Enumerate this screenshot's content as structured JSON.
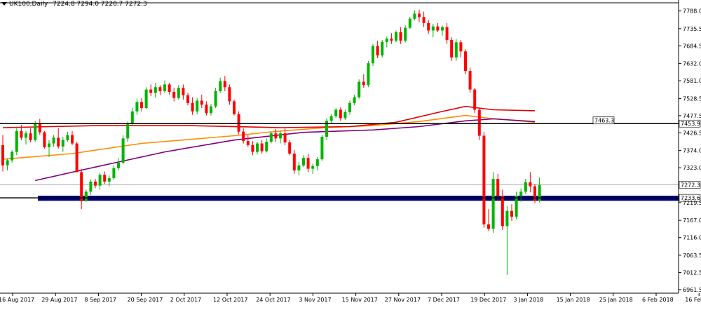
{
  "header": {
    "symbol": "UK100,Daily",
    "ohlc": "7224.8 7294.0 7220.7 7272.3"
  },
  "colors": {
    "bull": "#00b400",
    "bear": "#ff0000",
    "ma_fast": "#ff8c00",
    "ma_mid": "#e00000",
    "ma_slow": "#800080",
    "support_zone": "#000080",
    "hline": "#000000",
    "current_price_line": "#b0b0b0",
    "background": "#ffffff"
  },
  "chart_data": {
    "type": "candlestick",
    "title": "UK100,Daily",
    "y_ticks": [
      "7788.0",
      "7735.5",
      "7684.5",
      "7632.0",
      "7581.0",
      "7528.5",
      "7477.5",
      "7426.5",
      "7374.0",
      "7323.0",
      "7219.5",
      "7167.0",
      "7116.0",
      "7063.5",
      "7012.5",
      "6961.5"
    ],
    "x_ticks": [
      "16 Aug 2017",
      "29 Aug 2017",
      "8 Sep 2017",
      "20 Sep 2017",
      "2 Oct 2017",
      "12 Oct 2017",
      "24 Oct 2017",
      "3 Nov 2017",
      "15 Nov 2017",
      "27 Nov 2017",
      "7 Dec 2017",
      "19 Dec 2017",
      "3 Jan 2018",
      "15 Jan 2018",
      "25 Jan 2018",
      "6 Feb 2018",
      "16 Feb 2018"
    ],
    "ylim": [
      6951,
      7808
    ],
    "price_labels": {
      "level_1": "7453.9",
      "current": "7272.3",
      "level_2": "7233.6"
    },
    "horizontal_lines": [
      {
        "value": 7453.9,
        "label": "7453.9"
      },
      {
        "value": 7233.6,
        "label": "7233.6"
      }
    ],
    "object_label": {
      "text": "7463.3",
      "value": 7463.3
    },
    "support_zone": {
      "low": 7225,
      "high": 7240
    },
    "current_price": 7272.3,
    "candles": [
      [
        7390,
        7420,
        7312,
        7330
      ],
      [
        7330,
        7350,
        7315,
        7345
      ],
      [
        7345,
        7375,
        7338,
        7370
      ],
      [
        7370,
        7440,
        7360,
        7432
      ],
      [
        7432,
        7450,
        7405,
        7412
      ],
      [
        7412,
        7432,
        7392,
        7425
      ],
      [
        7425,
        7440,
        7398,
        7405
      ],
      [
        7405,
        7462,
        7400,
        7455
      ],
      [
        7455,
        7468,
        7420,
        7428
      ],
      [
        7428,
        7432,
        7380,
        7384
      ],
      [
        7384,
        7405,
        7355,
        7395
      ],
      [
        7395,
        7420,
        7385,
        7412
      ],
      [
        7412,
        7440,
        7380,
        7386
      ],
      [
        7386,
        7415,
        7370,
        7405
      ],
      [
        7405,
        7430,
        7400,
        7420
      ],
      [
        7420,
        7432,
        7390,
        7395
      ],
      [
        7395,
        7400,
        7335,
        7310
      ],
      [
        7310,
        7320,
        7200,
        7224
      ],
      [
        7224,
        7258,
        7222,
        7252
      ],
      [
        7252,
        7288,
        7242,
        7282
      ],
      [
        7282,
        7290,
        7262,
        7270
      ],
      [
        7270,
        7308,
        7258,
        7302
      ],
      [
        7302,
        7312,
        7275,
        7282
      ],
      [
        7282,
        7300,
        7268,
        7292
      ],
      [
        7292,
        7330,
        7288,
        7322
      ],
      [
        7322,
        7352,
        7315,
        7338
      ],
      [
        7338,
        7420,
        7333,
        7410
      ],
      [
        7410,
        7460,
        7400,
        7455
      ],
      [
        7455,
        7500,
        7448,
        7490
      ],
      [
        7490,
        7528,
        7480,
        7518
      ],
      [
        7518,
        7530,
        7490,
        7500
      ],
      [
        7500,
        7562,
        7498,
        7555
      ],
      [
        7555,
        7570,
        7535,
        7545
      ],
      [
        7545,
        7575,
        7530,
        7562
      ],
      [
        7562,
        7568,
        7538,
        7550
      ],
      [
        7550,
        7582,
        7545,
        7570
      ],
      [
        7570,
        7575,
        7540,
        7548
      ],
      [
        7548,
        7560,
        7520,
        7530
      ],
      [
        7530,
        7568,
        7525,
        7560
      ],
      [
        7560,
        7570,
        7525,
        7538
      ],
      [
        7538,
        7545,
        7508,
        7515
      ],
      [
        7515,
        7532,
        7480,
        7490
      ],
      [
        7490,
        7530,
        7482,
        7522
      ],
      [
        7522,
        7540,
        7500,
        7510
      ],
      [
        7510,
        7520,
        7478,
        7485
      ],
      [
        7485,
        7512,
        7478,
        7505
      ],
      [
        7505,
        7560,
        7500,
        7550
      ],
      [
        7550,
        7590,
        7545,
        7580
      ],
      [
        7580,
        7595,
        7550,
        7562
      ],
      [
        7562,
        7570,
        7510,
        7520
      ],
      [
        7520,
        7525,
        7478,
        7482
      ],
      [
        7482,
        7490,
        7422,
        7430
      ],
      [
        7430,
        7440,
        7395,
        7402
      ],
      [
        7402,
        7420,
        7385,
        7390
      ],
      [
        7390,
        7402,
        7360,
        7370
      ],
      [
        7370,
        7400,
        7362,
        7395
      ],
      [
        7395,
        7405,
        7365,
        7372
      ],
      [
        7372,
        7410,
        7368,
        7400
      ],
      [
        7400,
        7430,
        7395,
        7425
      ],
      [
        7425,
        7438,
        7400,
        7410
      ],
      [
        7410,
        7432,
        7395,
        7425
      ],
      [
        7425,
        7440,
        7390,
        7398
      ],
      [
        7398,
        7405,
        7360,
        7365
      ],
      [
        7365,
        7375,
        7305,
        7315
      ],
      [
        7315,
        7340,
        7300,
        7330
      ],
      [
        7330,
        7360,
        7325,
        7352
      ],
      [
        7352,
        7365,
        7310,
        7320
      ],
      [
        7320,
        7335,
        7305,
        7328
      ],
      [
        7328,
        7355,
        7315,
        7348
      ],
      [
        7348,
        7420,
        7343,
        7415
      ],
      [
        7415,
        7470,
        7405,
        7462
      ],
      [
        7462,
        7482,
        7455,
        7476
      ],
      [
        7476,
        7500,
        7470,
        7495
      ],
      [
        7495,
        7502,
        7462,
        7470
      ],
      [
        7470,
        7495,
        7465,
        7488
      ],
      [
        7488,
        7522,
        7480,
        7515
      ],
      [
        7515,
        7540,
        7508,
        7532
      ],
      [
        7532,
        7585,
        7528,
        7578
      ],
      [
        7578,
        7600,
        7560,
        7568
      ],
      [
        7568,
        7640,
        7562,
        7633
      ],
      [
        7633,
        7690,
        7625,
        7684
      ],
      [
        7684,
        7700,
        7648,
        7656
      ],
      [
        7656,
        7702,
        7650,
        7696
      ],
      [
        7696,
        7712,
        7680,
        7706
      ],
      [
        7706,
        7722,
        7690,
        7700
      ],
      [
        7700,
        7730,
        7695,
        7725
      ],
      [
        7725,
        7740,
        7690,
        7700
      ],
      [
        7700,
        7745,
        7695,
        7738
      ],
      [
        7738,
        7770,
        7735,
        7765
      ],
      [
        7765,
        7790,
        7760,
        7780
      ],
      [
        7780,
        7792,
        7755,
        7770
      ],
      [
        7770,
        7786,
        7740,
        7752
      ],
      [
        7752,
        7762,
        7720,
        7730
      ],
      [
        7730,
        7750,
        7710,
        7742
      ],
      [
        7742,
        7752,
        7725,
        7730
      ],
      [
        7730,
        7745,
        7715,
        7740
      ],
      [
        7740,
        7752,
        7690,
        7702
      ],
      [
        7702,
        7710,
        7640,
        7650
      ],
      [
        7650,
        7705,
        7640,
        7695
      ],
      [
        7695,
        7702,
        7650,
        7668
      ],
      [
        7668,
        7675,
        7600,
        7610
      ],
      [
        7610,
        7620,
        7545,
        7555
      ],
      [
        7555,
        7560,
        7485,
        7495
      ],
      [
        7495,
        7500,
        7405,
        7418
      ],
      [
        7418,
        7430,
        7145,
        7155
      ],
      [
        7155,
        7200,
        7135,
        7142
      ],
      [
        7142,
        7310,
        7130,
        7290
      ],
      [
        7290,
        7305,
        7225,
        7240
      ],
      [
        7240,
        7258,
        7138,
        7150
      ],
      [
        7150,
        7210,
        7005,
        7195
      ],
      [
        7195,
        7215,
        7165,
        7178
      ],
      [
        7178,
        7252,
        7170,
        7240
      ],
      [
        7240,
        7262,
        7222,
        7252
      ],
      [
        7252,
        7290,
        7245,
        7280
      ],
      [
        7280,
        7310,
        7250,
        7268
      ],
      [
        7268,
        7275,
        7218,
        7225
      ],
      [
        7224.8,
        7294.0,
        7220.7,
        7272.3
      ]
    ],
    "moving_averages": [
      {
        "kind": "fast",
        "points": [
          [
            0,
            7348
          ],
          [
            15,
            7365
          ],
          [
            30,
            7395
          ],
          [
            50,
            7418
          ],
          [
            60,
            7432
          ],
          [
            70,
            7442
          ],
          [
            80,
            7448
          ],
          [
            90,
            7460
          ],
          [
            100,
            7478
          ],
          [
            105,
            7470
          ],
          [
            115,
            7458
          ]
        ]
      },
      {
        "kind": "mid",
        "points": [
          [
            0,
            7442
          ],
          [
            20,
            7448
          ],
          [
            40,
            7448
          ],
          [
            60,
            7442
          ],
          [
            75,
            7445
          ],
          [
            85,
            7458
          ],
          [
            95,
            7490
          ],
          [
            100,
            7505
          ],
          [
            106,
            7495
          ],
          [
            115,
            7492
          ]
        ]
      },
      {
        "kind": "slow",
        "points": [
          [
            7,
            7285
          ],
          [
            20,
            7325
          ],
          [
            35,
            7370
          ],
          [
            50,
            7405
          ],
          [
            65,
            7428
          ],
          [
            80,
            7435
          ],
          [
            90,
            7445
          ],
          [
            100,
            7462
          ],
          [
            106,
            7468
          ],
          [
            115,
            7460
          ]
        ]
      }
    ]
  }
}
